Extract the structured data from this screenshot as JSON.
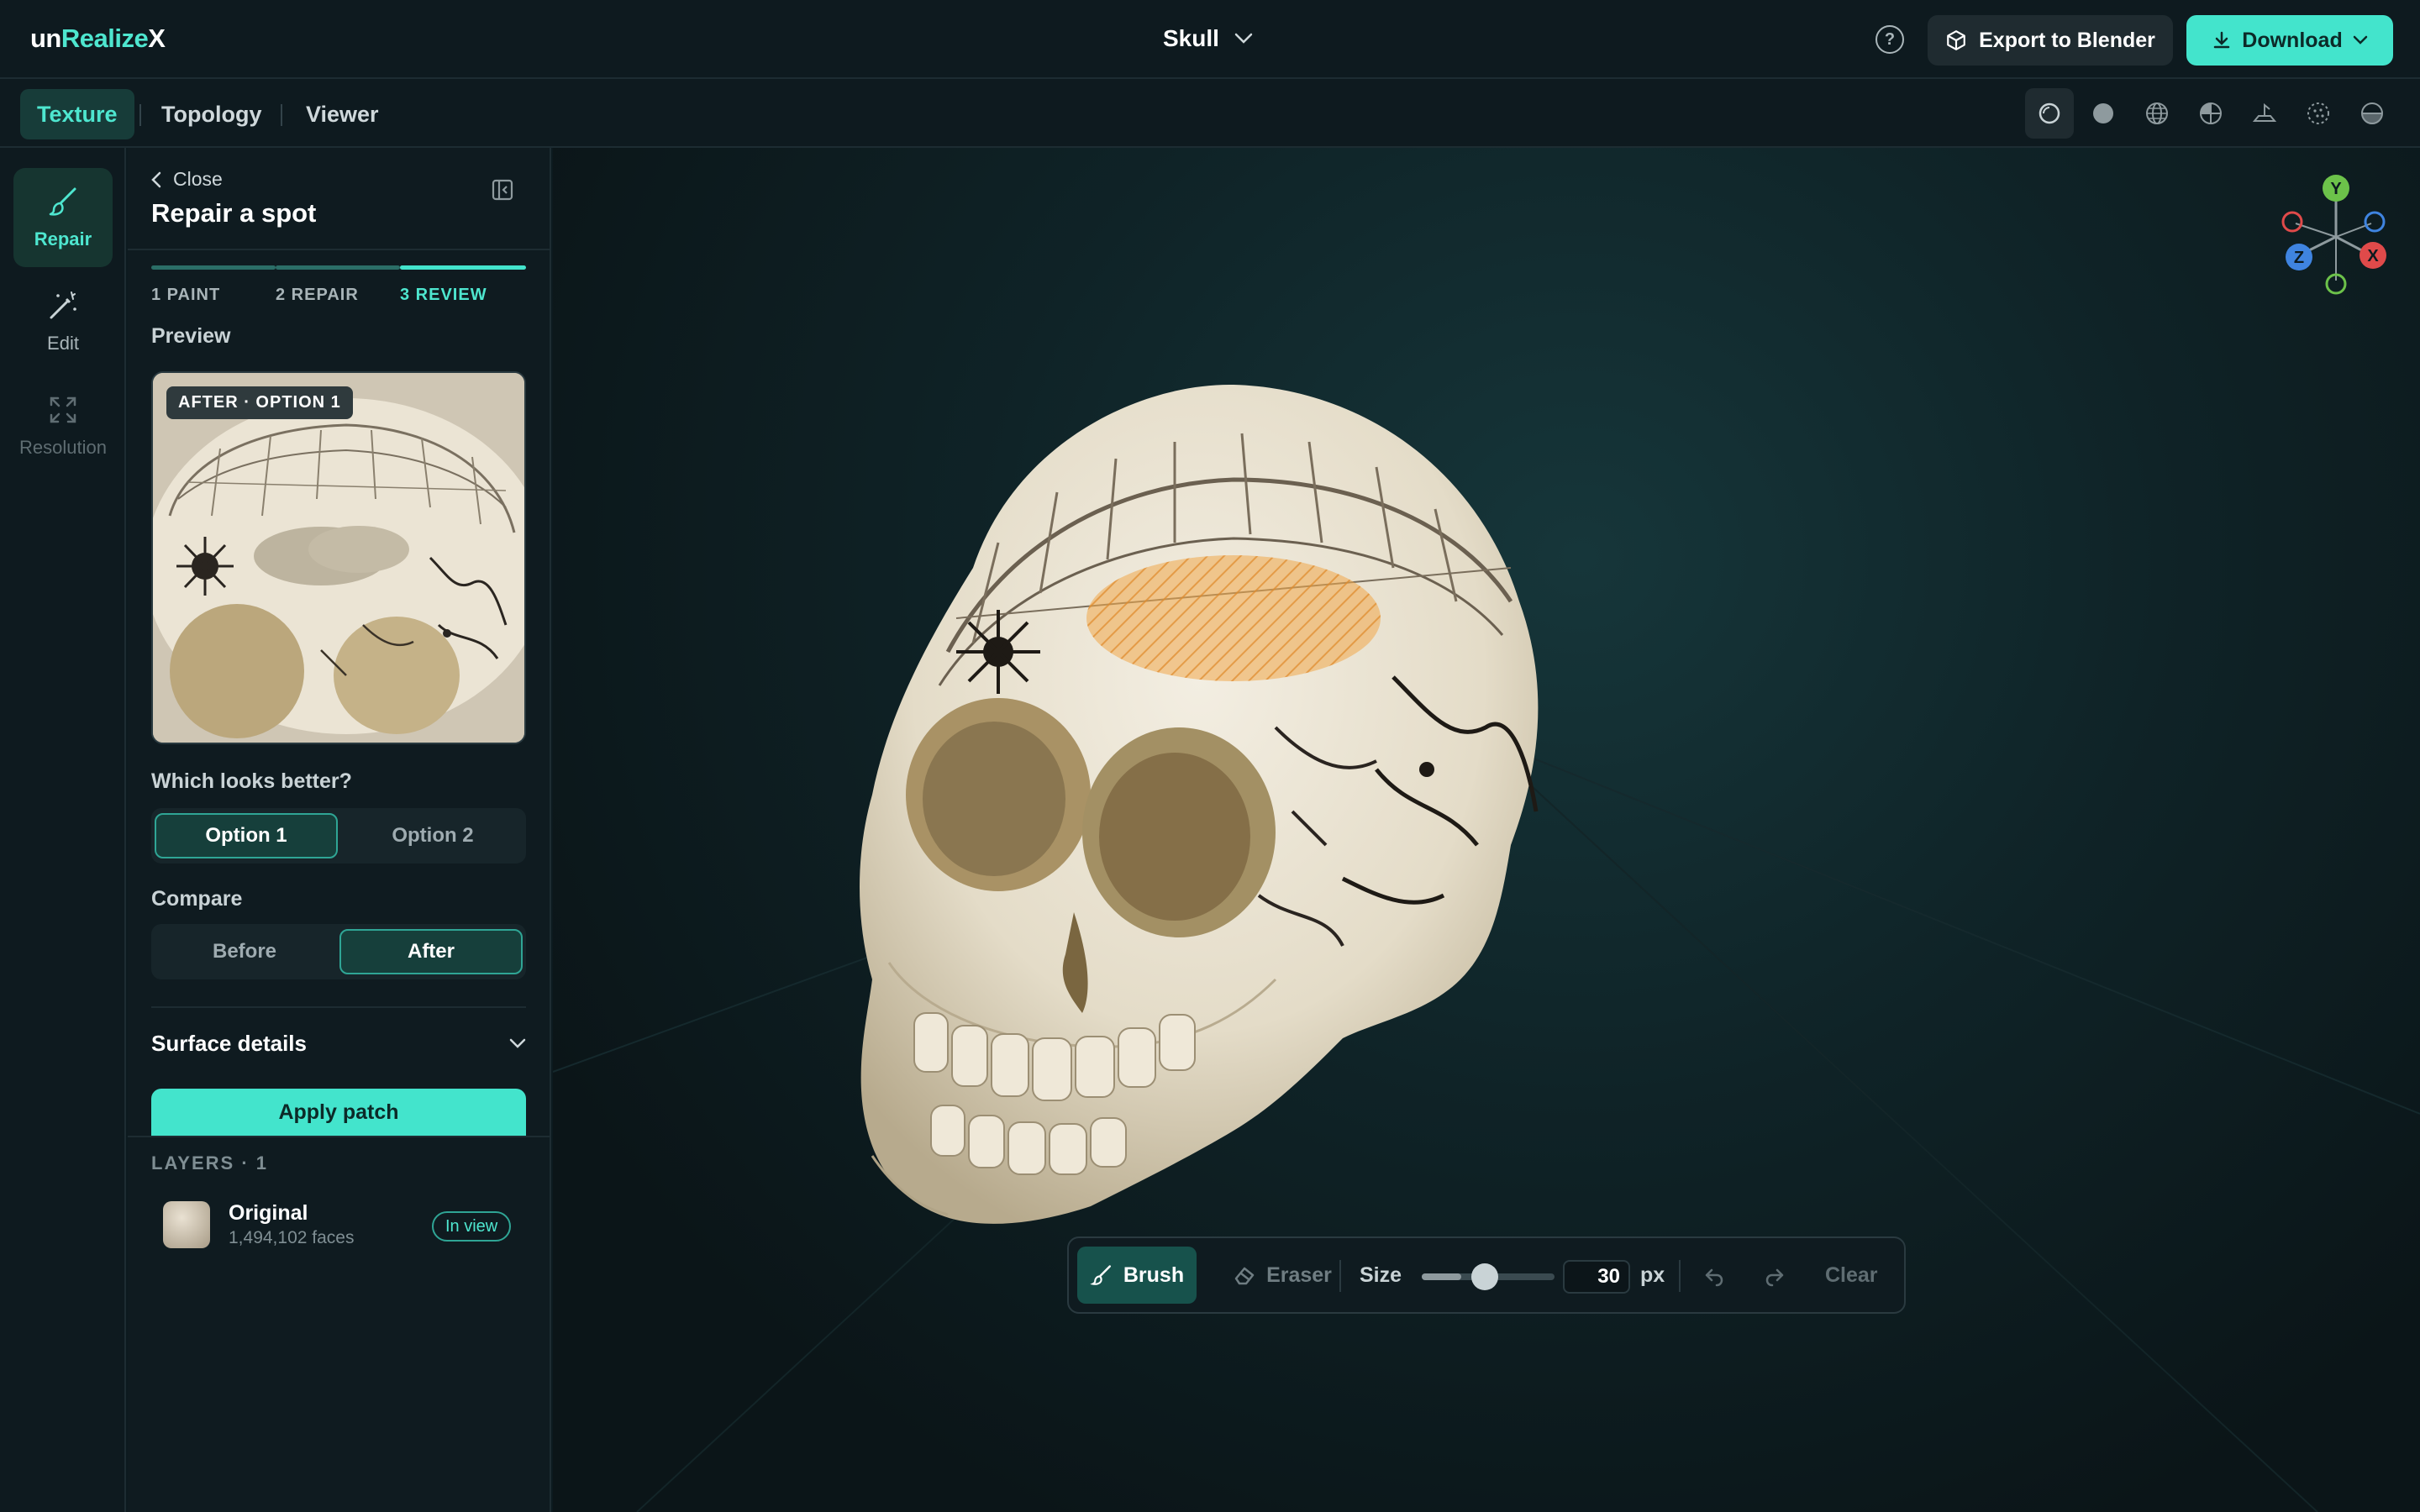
{
  "app": {
    "logo_prefix": "un",
    "logo_accent": "Realize",
    "logo_suffix": "X"
  },
  "header": {
    "project_name": "Skull",
    "help_icon": "help-circle-icon",
    "export_label": "Export to Blender",
    "download_label": "Download"
  },
  "tabs": [
    {
      "label": "Texture",
      "active": true
    },
    {
      "label": "Topology",
      "active": false
    },
    {
      "label": "Viewer",
      "active": false
    }
  ],
  "shading_modes": [
    "solid-circle-outline-icon",
    "solid-sphere-icon",
    "wireframe-globe-icon",
    "quadrant-sphere-icon",
    "ground-plane-icon",
    "dotted-sphere-icon",
    "half-sphere-icon"
  ],
  "rail": [
    {
      "label": "Repair",
      "icon": "brush-icon",
      "active": true
    },
    {
      "label": "Edit",
      "icon": "magic-wand-icon",
      "active": false
    },
    {
      "label": "Resolution",
      "icon": "expand-arrows-icon",
      "disabled": true
    }
  ],
  "panel": {
    "close_label": "Close",
    "title": "Repair a spot",
    "steps": [
      {
        "label": "1 PAINT",
        "active": false
      },
      {
        "label": "2 REPAIR",
        "active": false
      },
      {
        "label": "3 REVIEW",
        "active": true
      }
    ],
    "preview_label": "Preview",
    "preview_badge": "AFTER · OPTION 1",
    "question": "Which looks better?",
    "options": [
      {
        "label": "Option 1",
        "active": true
      },
      {
        "label": "Option 2",
        "active": false
      }
    ],
    "compare_label": "Compare",
    "compare": [
      {
        "label": "Before",
        "active": false
      },
      {
        "label": "After",
        "active": true
      }
    ],
    "surface_details_label": "Surface details",
    "apply_label": "Apply patch"
  },
  "layers": {
    "header": "LAYERS · 1",
    "items": [
      {
        "name": "Original",
        "faces": "1,494,102 faces",
        "badge": "In view"
      }
    ]
  },
  "axes": {
    "y": "Y",
    "x": "X",
    "z": "Z"
  },
  "toolbar": {
    "brush_label": "Brush",
    "eraser_label": "Eraser",
    "size_label": "Size",
    "size_value": "30",
    "size_fraction": 0.3,
    "size_unit": "px",
    "clear_label": "Clear"
  },
  "colors": {
    "accent": "#43e4cc",
    "background": "#0c1a1f",
    "highlight_patch": "#f0a84a"
  }
}
